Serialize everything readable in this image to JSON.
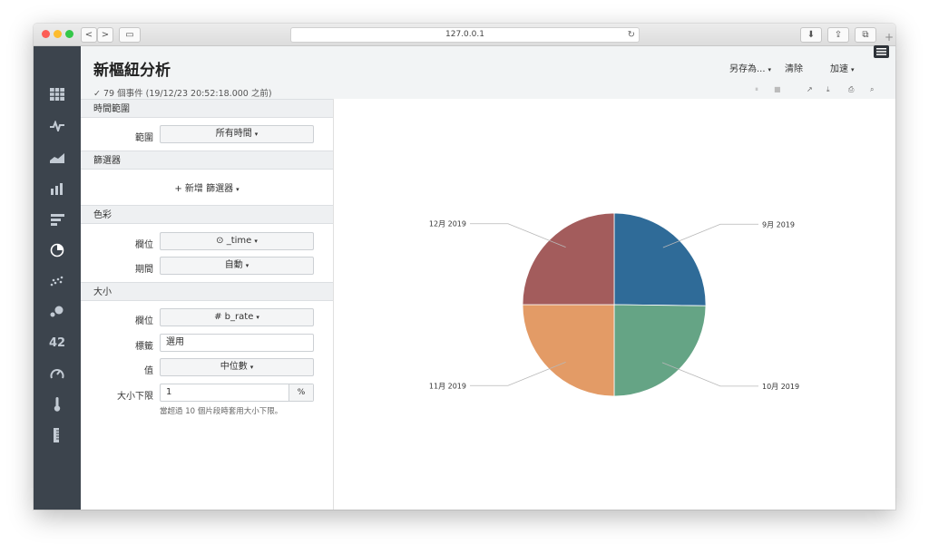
{
  "browser": {
    "url": "127.0.0.1",
    "back_icon": "<",
    "forward_icon": ">",
    "sidebar_icon": "▭",
    "reload_icon": "↻",
    "download_icon": "⬇",
    "share_icon": "⇪",
    "tabs_icon": "⧉",
    "newtab_icon": "+"
  },
  "nav": {
    "items": [
      "table-icon",
      "pulse-icon",
      "area-chart-icon",
      "bar-chart-icon",
      "horizontal-bar-icon",
      "pie-chart-icon",
      "scatter-icon",
      "bubble-icon",
      "single-value",
      "gauge-icon",
      "thermometer-icon",
      "ruler-icon"
    ],
    "single_value_label": "42"
  },
  "header": {
    "title": "新樞紐分析",
    "status_check": "✓",
    "status": "79 個事件 (19/12/23 20:52:18.000 之前)",
    "save_as": "另存為...",
    "clear": "清除",
    "accelerate": "加速",
    "caret": "▾",
    "tools": {
      "pause": "⏸",
      "stop": "■",
      "share": "↗",
      "export": "⤓",
      "print": "⎙",
      "inspect": "⌕"
    }
  },
  "panel": {
    "time_range": {
      "header": "時間範圍",
      "range_label": "範圍",
      "range_value": "所有時間"
    },
    "filters": {
      "header": "篩選器",
      "add_label": "+ 新增 篩選器"
    },
    "color": {
      "header": "色彩",
      "field_label": "欄位",
      "field_value": "⊙ _time",
      "period_label": "期間",
      "period_value": "自動"
    },
    "size": {
      "header": "大小",
      "field_label": "欄位",
      "field_value": "# b_rate",
      "tag_label": "標籤",
      "tag_value": "選用",
      "value_label": "值",
      "value_value": "中位數",
      "minsize_label": "大小下限",
      "minsize_value": "1",
      "minsize_unit": "%",
      "help": "當超過 10 個片段時套用大小下限。"
    }
  },
  "chart_data": {
    "type": "pie",
    "slices": [
      {
        "label": "9月 2019",
        "value": 25.2,
        "color": "#2f6b98"
      },
      {
        "label": "10月 2019",
        "value": 24.8,
        "color": "#65a485"
      },
      {
        "label": "11月 2019",
        "value": 25.0,
        "color": "#e39b66"
      },
      {
        "label": "12月 2019",
        "value": 25.0,
        "color": "#a35c5c"
      }
    ]
  }
}
